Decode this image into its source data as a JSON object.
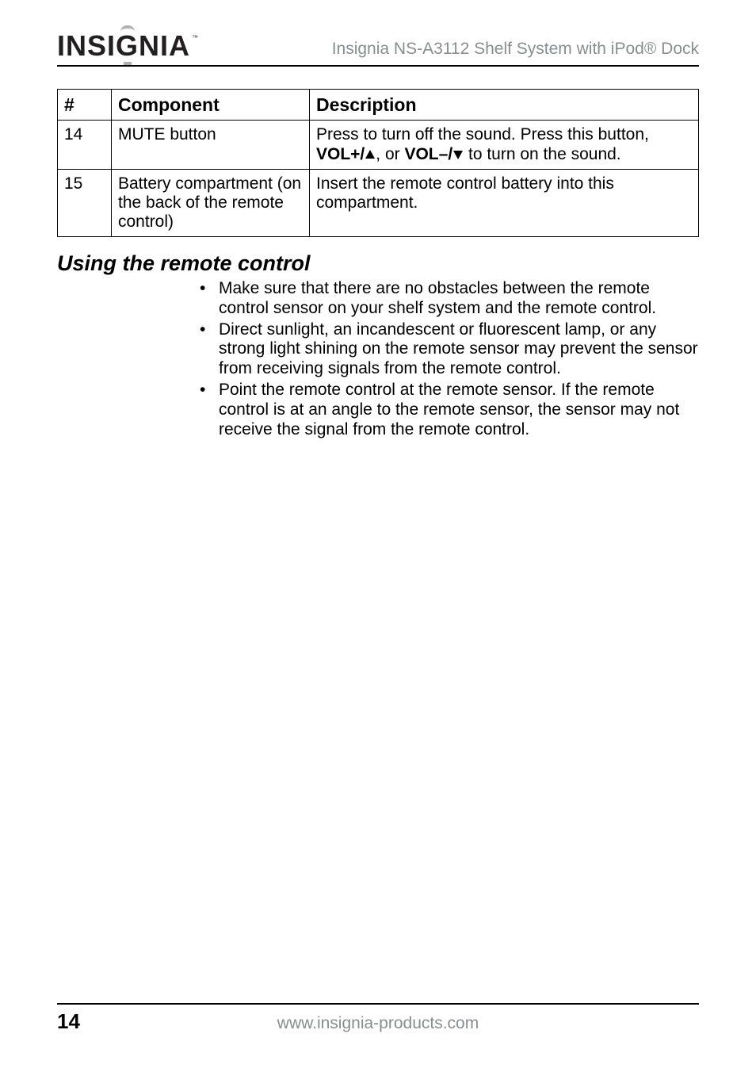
{
  "header": {
    "brand_pre": "INSI",
    "brand_g": "G",
    "brand_post": "NIA",
    "brand_tm": "™",
    "doc_title": "Insignia NS-A3112 Shelf System with iPod® Dock"
  },
  "table": {
    "headers": {
      "num": "#",
      "component": "Component",
      "description": "Description"
    },
    "rows": [
      {
        "num": "14",
        "component": "MUTE button",
        "desc_pre": "Press to turn off the sound. Press this button, ",
        "desc_b1": "VOL+/",
        "desc_mid1": ", or ",
        "desc_b2": "VOL–/",
        "desc_post": " to turn on the sound."
      },
      {
        "num": "15",
        "component": "Battery compartment (on the back of the remote control)",
        "desc_plain": "Insert the remote control battery into this compartment."
      }
    ]
  },
  "section_heading": "Using the remote control",
  "notes": [
    "Make sure that there are no obstacles between the remote control sensor on your shelf system and the remote control.",
    "Direct sunlight, an incandescent or fluorescent lamp, or any strong light shining on the remote sensor may prevent the sensor from receiving signals from the remote control.",
    "Point the remote control at the remote sensor. If the remote control is at an angle to the remote sensor, the sensor may not receive the signal from the remote control."
  ],
  "footer": {
    "page": "14",
    "url": "www.insignia-products.com"
  }
}
